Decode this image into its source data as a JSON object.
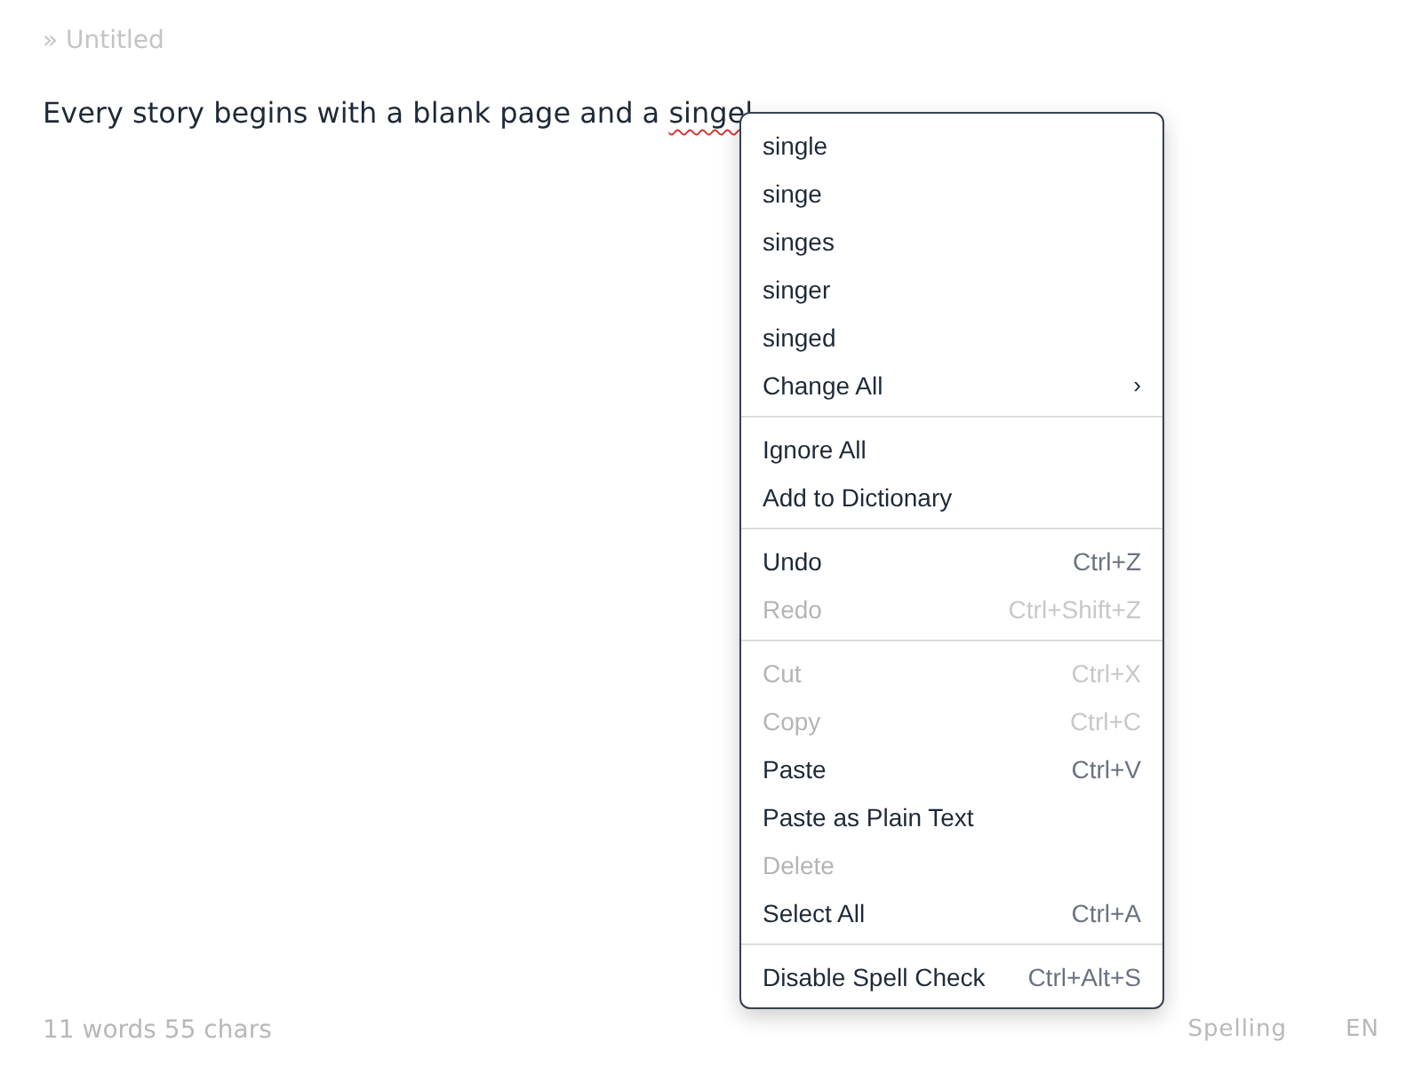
{
  "breadcrumb": "» Untitled",
  "paragraph": {
    "before": "Every story begins with a blank page and a ",
    "word": "singel",
    "misspelled": true
  },
  "context_menu": [
    {
      "kind": "item",
      "label": "single",
      "disabled": false
    },
    {
      "kind": "item",
      "label": "singe",
      "disabled": false
    },
    {
      "kind": "item",
      "label": "singes",
      "disabled": false
    },
    {
      "kind": "item",
      "label": "singer",
      "disabled": false
    },
    {
      "kind": "item",
      "label": "singed",
      "disabled": false
    },
    {
      "kind": "submenu",
      "label": "Change All",
      "arrow": "›",
      "disabled": false
    },
    {
      "kind": "separator"
    },
    {
      "kind": "item",
      "label": "Ignore All",
      "disabled": false
    },
    {
      "kind": "item",
      "label": "Add to Dictionary",
      "disabled": false
    },
    {
      "kind": "separator"
    },
    {
      "kind": "item",
      "label": "Undo",
      "shortcut": "Ctrl+Z",
      "disabled": false
    },
    {
      "kind": "item",
      "label": "Redo",
      "shortcut": "Ctrl+Shift+Z",
      "disabled": true
    },
    {
      "kind": "separator"
    },
    {
      "kind": "item",
      "label": "Cut",
      "shortcut": "Ctrl+X",
      "disabled": true
    },
    {
      "kind": "item",
      "label": "Copy",
      "shortcut": "Ctrl+C",
      "disabled": true
    },
    {
      "kind": "item",
      "label": "Paste",
      "shortcut": "Ctrl+V",
      "disabled": false
    },
    {
      "kind": "item",
      "label": "Paste as Plain Text",
      "disabled": false
    },
    {
      "kind": "item",
      "label": "Delete",
      "disabled": true
    },
    {
      "kind": "item",
      "label": "Select All",
      "shortcut": "Ctrl+A",
      "disabled": false
    },
    {
      "kind": "separator"
    },
    {
      "kind": "item",
      "label": "Disable Spell Check",
      "shortcut": "Ctrl+Alt+S",
      "disabled": false
    }
  ],
  "status_bar": {
    "count": "11 words 55 chars",
    "spelling": "Spelling",
    "language": "EN"
  }
}
